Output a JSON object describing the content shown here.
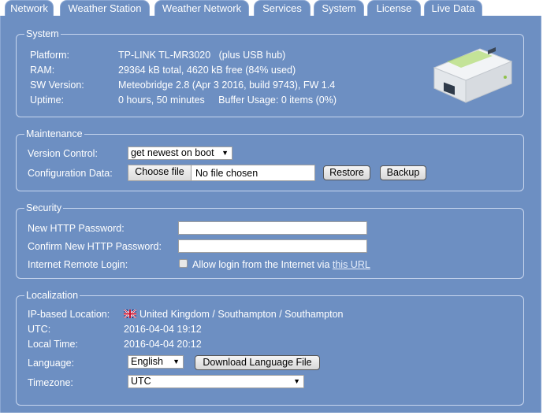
{
  "tabs": [
    {
      "label": "Network",
      "active": false
    },
    {
      "label": "Weather Station",
      "active": false
    },
    {
      "label": "Weather Network",
      "active": false
    },
    {
      "label": "Services",
      "active": false
    },
    {
      "label": "System",
      "active": true
    },
    {
      "label": "License",
      "active": false
    },
    {
      "label": "Live Data",
      "active": false
    }
  ],
  "system": {
    "legend": "System",
    "platform_label": "Platform:",
    "platform_value": "TP-LINK TL-MR3020   (plus USB hub)",
    "ram_label": "RAM:",
    "ram_value": "29364 kB total, 4620 kB free (84% used)",
    "sw_label": "SW Version:",
    "sw_value": "Meteobridge 2.8 (Apr 3 2016, build 9743), FW 1.4",
    "uptime_label": "Uptime:",
    "uptime_value": "0 hours, 50 minutes     Buffer Usage: 0 items (0%)",
    "device_image": "router-image"
  },
  "maintenance": {
    "legend": "Maintenance",
    "version_label": "Version Control:",
    "version_value": "get newest on boot",
    "config_label": "Configuration Data:",
    "choose_file": "Choose file",
    "no_file": "No file chosen",
    "restore": "Restore",
    "backup": "Backup"
  },
  "security": {
    "legend": "Security",
    "new_pw_label": "New HTTP Password:",
    "new_pw_value": "",
    "confirm_pw_label": "Confirm New HTTP Password:",
    "confirm_pw_value": "",
    "remote_label": "Internet Remote Login:",
    "allow_text": "Allow login from the Internet via ",
    "allow_link": "this URL",
    "allow_checked": false
  },
  "localization": {
    "legend": "Localization",
    "ip_label": "IP-based Location:",
    "ip_value": "United Kingdom / Southampton / Southampton",
    "utc_label": "UTC:",
    "utc_value": "2016-04-04 19:12",
    "local_label": "Local Time:",
    "local_value": "2016-04-04 20:12",
    "language_label": "Language:",
    "language_value": "English",
    "download_lang": "Download Language File",
    "timezone_label": "Timezone:",
    "timezone_value": "UTC"
  }
}
